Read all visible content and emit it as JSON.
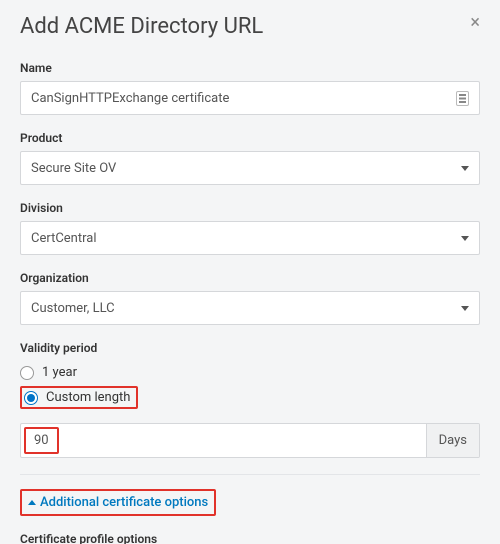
{
  "header": {
    "title": "Add ACME Directory URL",
    "close_label": "×"
  },
  "fields": {
    "name": {
      "label": "Name",
      "value": "CanSignHTTPExchange certificate"
    },
    "product": {
      "label": "Product",
      "value": "Secure Site OV"
    },
    "division": {
      "label": "Division",
      "value": "CertCentral"
    },
    "organization": {
      "label": "Organization",
      "value": "Customer, LLC"
    }
  },
  "validity": {
    "label": "Validity period",
    "option_1year": "1 year",
    "option_custom": "Custom length",
    "days_value": "90",
    "days_unit": "Days"
  },
  "additional": {
    "toggle_label": "Additional certificate options",
    "profile_label": "Certificate profile options"
  }
}
